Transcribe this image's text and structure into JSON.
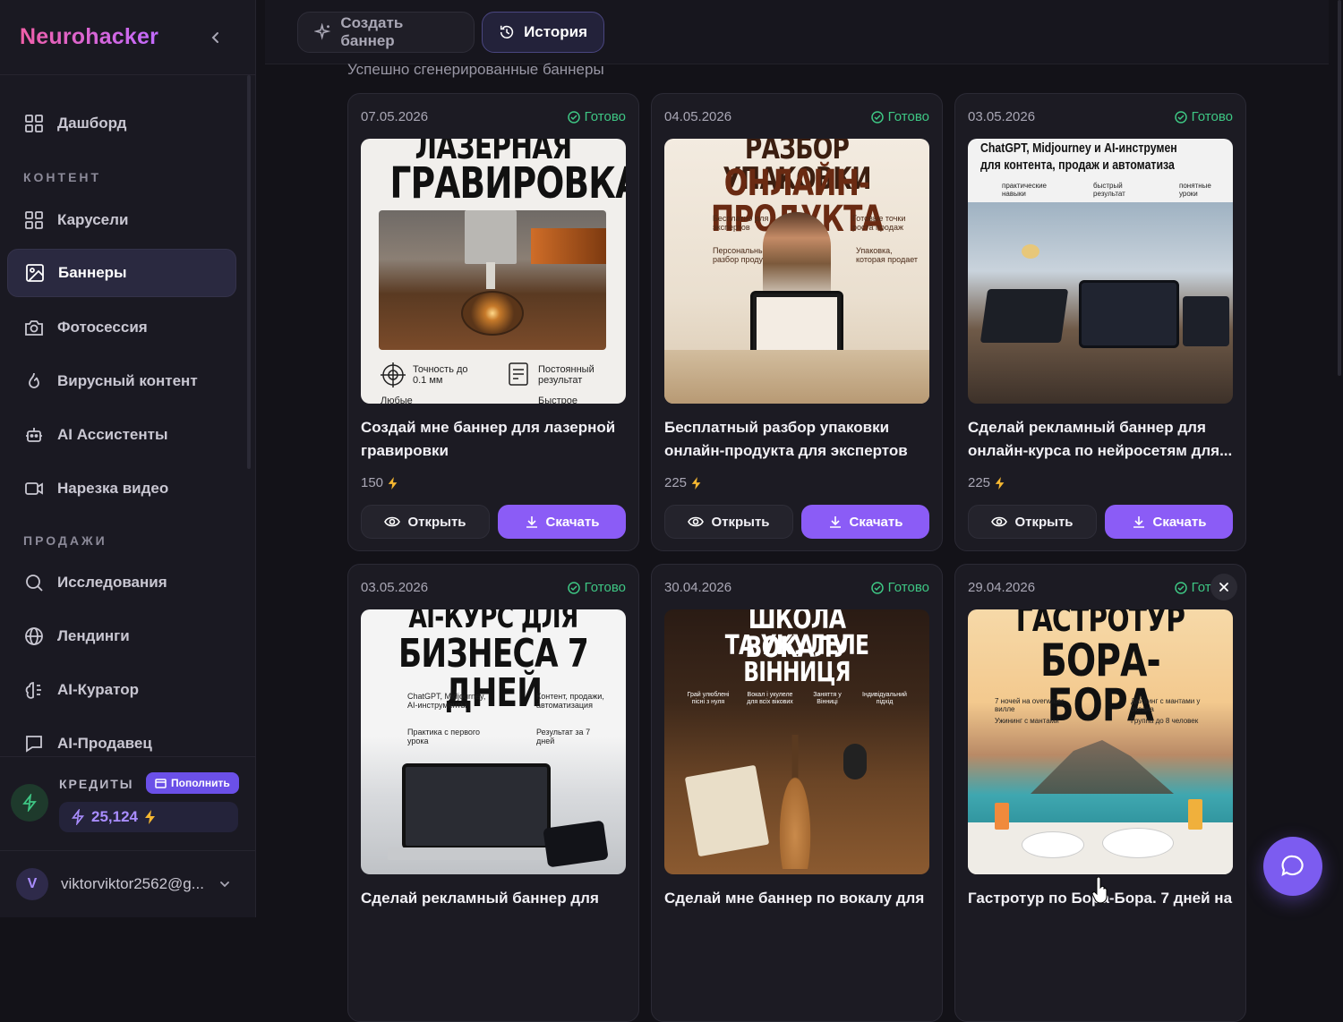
{
  "brand": "Neurohacker",
  "nav": {
    "sections": {
      "content": "КОНТЕНТ",
      "sales": "ПРОДАЖИ"
    },
    "items": [
      {
        "label": "Дашборд",
        "icon": "grid-icon"
      },
      {
        "label": "Карусели",
        "icon": "grid-icon"
      },
      {
        "label": "Баннеры",
        "icon": "image-icon"
      },
      {
        "label": "Фотосессия",
        "icon": "camera-icon"
      },
      {
        "label": "Вирусный контент",
        "icon": "flame-icon"
      },
      {
        "label": "AI Ассистенты",
        "icon": "bot-icon"
      },
      {
        "label": "Нарезка видео",
        "icon": "video-icon"
      },
      {
        "label": "Исследования",
        "icon": "search-icon"
      },
      {
        "label": "Лендинги",
        "icon": "globe-icon"
      },
      {
        "label": "AI-Куратор",
        "icon": "brain-icon"
      },
      {
        "label": "AI-Продавец",
        "icon": "message-icon"
      }
    ]
  },
  "credits": {
    "label": "КРЕДИТЫ",
    "topup": "Пополнить",
    "amount": "25,124"
  },
  "user": {
    "initial": "V",
    "email": "viktorviktor2562@g..."
  },
  "tabs": {
    "create": "Создать баннер",
    "history": "История"
  },
  "subtitle": "Успешно сгенерированные баннеры",
  "colors": {
    "accent": "#8b5cf6",
    "status": "#3ec784",
    "brand_from": "#f05fa8",
    "brand_to": "#c26bff"
  },
  "cards": [
    {
      "date": "07.05.2026",
      "status": "Готово",
      "title": "Создай мне баннер для лазерной гравировки",
      "cost": "150",
      "open": "Открыть",
      "download": "Скачать",
      "img": {
        "h1": "ЛАЗЕРНАЯ",
        "h2": "ГРАВИРОВКА",
        "c1": "Точность до 0.1 мм",
        "c2": "Постоянный результат",
        "c3": "Любые",
        "c4": "Быстрое"
      }
    },
    {
      "date": "04.05.2026",
      "status": "Готово",
      "title": "Бесплатный разбор упаковки онлайн-продукта для экспертов",
      "cost": "225",
      "open": "Открыть",
      "download": "Скачать",
      "img": {
        "h1": "РАЗБОР УПАКОВКИ",
        "h2": "ОНЛАЙН-ПРОДУКТА",
        "c1": "Бесплатно для экспертов",
        "c2": "Готовые точки роста продаж",
        "c3": "Персональный разбор продукта",
        "c4": "Упаковка, которая продает"
      }
    },
    {
      "date": "03.05.2026",
      "status": "Готово",
      "title": "Сделай рекламный баннер для онлайн-курса по нейросетям для...",
      "cost": "225",
      "open": "Открыть",
      "download": "Скачать",
      "img": {
        "h1": "ChatGPT, Midjourney и AI-инструмен",
        "h2": "для контента, продаж и автоматиза",
        "c1": "практические навыки",
        "c2": "быстрый результат",
        "c3": "понятные уроки"
      }
    },
    {
      "date": "03.05.2026",
      "status": "Готово",
      "title": "Сделай рекламный баннер для",
      "cost": "",
      "open": "Открыть",
      "download": "Скачать",
      "img": {
        "h1": "AI-КУРС ДЛЯ",
        "h2": "БИЗНЕСА 7 ДНЕЙ",
        "c1": "ChatGPT, Midjourney, AI-инструменты",
        "c2": "Контент, продажи, автоматизация",
        "c3": "Практика с первого урока",
        "c4": "Результат за 7 дней"
      }
    },
    {
      "date": "30.04.2026",
      "status": "Готово",
      "title": "Сделай мне баннер по вокалу для",
      "cost": "",
      "open": "Открыть",
      "download": "Скачать",
      "img": {
        "h1": "ШКОЛА ВОКАЛУ",
        "h2": "ТА УКУЛЕЛЕ ВІННИЦЯ",
        "c1": "Грай улюблені пісні з нуля",
        "c2": "Вокал і укулеле для всіх віковиx",
        "c3": "Заняття у Вінниці",
        "c4": "Індивідуальний підхід"
      }
    },
    {
      "date": "29.04.2026",
      "status": "Готово",
      "title": "Гастротур по Бора-Бора. 7 дней на",
      "cost": "",
      "open": "Открыть",
      "download": "Скачать",
      "img": {
        "h1": "ГАСТРОТУР",
        "h2": "БОРА-БОРА",
        "c1": "7 ночей на overwater-вилле",
        "c2": "Дайвинг с мантами у океана",
        "c3": "Ужининг с мантами",
        "c4": "Группа до 8 человек"
      }
    }
  ]
}
